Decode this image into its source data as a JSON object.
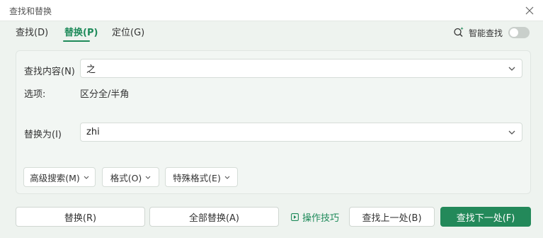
{
  "window": {
    "title": "查找和替换"
  },
  "tabs": [
    {
      "label": "查找(D)"
    },
    {
      "label": "替换(P)"
    },
    {
      "label": "定位(G)"
    }
  ],
  "smart_search": {
    "label": "智能查找",
    "enabled": false
  },
  "find": {
    "label": "查找内容(N)",
    "value": "之"
  },
  "options": {
    "label": "选项:",
    "value": "区分全/半角"
  },
  "replace": {
    "label": "替换为(I)",
    "value": "zhi"
  },
  "dropdowns": {
    "advanced": "高级搜索(M)",
    "format": "格式(O)",
    "special": "特殊格式(E)"
  },
  "buttons": {
    "replace": "替换(R)",
    "replace_all": "全部替换(A)",
    "tips": "操作技巧",
    "find_prev": "查找上一处(B)",
    "find_next": "查找下一处(F)"
  },
  "colors": {
    "accent": "#23895a",
    "background": "#eef3ef"
  }
}
